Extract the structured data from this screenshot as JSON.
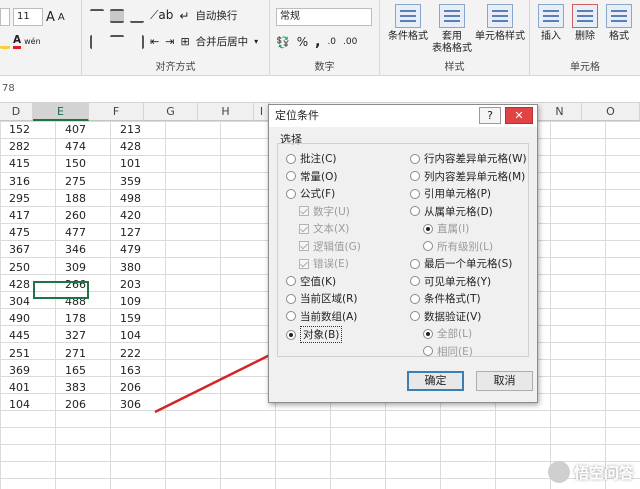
{
  "ribbon": {
    "font_size": "11",
    "font_grow": "A",
    "font_shrink": "A",
    "phonetic": "wén",
    "wrap_text": "自动换行",
    "merge_center": "合并后居中",
    "number_format": "常规",
    "group_align": "对齐方式",
    "group_number": "数字",
    "group_styles": "样式",
    "group_cells": "单元格",
    "cond_format": "条件格式",
    "table_format_1": "套用",
    "table_format_2": "表格格式",
    "cell_styles": "单元格样式",
    "insert": "插入",
    "delete": "删除",
    "format": "格式",
    "percent": "%",
    "comma": ","
  },
  "formula_bar": {
    "value": "78"
  },
  "columns": [
    {
      "label": "D"
    },
    {
      "label": "E"
    },
    {
      "label": "F"
    },
    {
      "label": "G"
    },
    {
      "label": "H"
    },
    {
      "label": "I"
    },
    {
      "label": "N"
    },
    {
      "label": "O"
    }
  ],
  "sheet_rows": [
    [
      "152",
      "407",
      "213"
    ],
    [
      "282",
      "474",
      "428"
    ],
    [
      "415",
      "150",
      "101"
    ],
    [
      "316",
      "275",
      "359"
    ],
    [
      "295",
      "188",
      "498"
    ],
    [
      "417",
      "260",
      "420"
    ],
    [
      "475",
      "477",
      "127"
    ],
    [
      "367",
      "346",
      "479"
    ],
    [
      "250",
      "309",
      "380"
    ],
    [
      "428",
      "266",
      "203"
    ],
    [
      "304",
      "488",
      "109"
    ],
    [
      "490",
      "178",
      "159"
    ],
    [
      "445",
      "327",
      "104"
    ],
    [
      "251",
      "271",
      "222"
    ],
    [
      "369",
      "165",
      "163"
    ],
    [
      "401",
      "383",
      "206"
    ],
    [
      "104",
      "206",
      "306"
    ]
  ],
  "dialog": {
    "title": "定位条件",
    "help": "?",
    "close": "✕",
    "section": "选择",
    "left_options": [
      {
        "label": "批注(C)",
        "state": "off"
      },
      {
        "label": "常量(O)",
        "state": "off"
      },
      {
        "label": "公式(F)",
        "state": "off"
      },
      {
        "label": "数字(U)",
        "state": "check-disabled"
      },
      {
        "label": "文本(X)",
        "state": "check-disabled"
      },
      {
        "label": "逻辑值(G)",
        "state": "check-disabled"
      },
      {
        "label": "错误(E)",
        "state": "check-disabled"
      },
      {
        "label": "空值(K)",
        "state": "off"
      },
      {
        "label": "当前区域(R)",
        "state": "off"
      },
      {
        "label": "当前数组(A)",
        "state": "off"
      },
      {
        "label": "对象(B)",
        "state": "on"
      }
    ],
    "right_options": [
      {
        "label": "行内容差异单元格(W)",
        "state": "off"
      },
      {
        "label": "列内容差异单元格(M)",
        "state": "off"
      },
      {
        "label": "引用单元格(P)",
        "state": "off"
      },
      {
        "label": "从属单元格(D)",
        "state": "off"
      },
      {
        "label": "直属(I)",
        "state": "radio-disabled-on"
      },
      {
        "label": "所有级别(L)",
        "state": "radio-disabled"
      },
      {
        "label": "最后一个单元格(S)",
        "state": "off"
      },
      {
        "label": "可见单元格(Y)",
        "state": "off"
      },
      {
        "label": "条件格式(T)",
        "state": "off"
      },
      {
        "label": "数据验证(V)",
        "state": "off"
      },
      {
        "label": "全部(L)",
        "state": "radio-disabled-on"
      },
      {
        "label": "相同(E)",
        "state": "radio-disabled"
      }
    ],
    "ok": "确定",
    "cancel": "取消"
  },
  "watermark": "悟空问答",
  "colors": {
    "excel_green": "#217346",
    "arrow_red": "#d42424"
  }
}
